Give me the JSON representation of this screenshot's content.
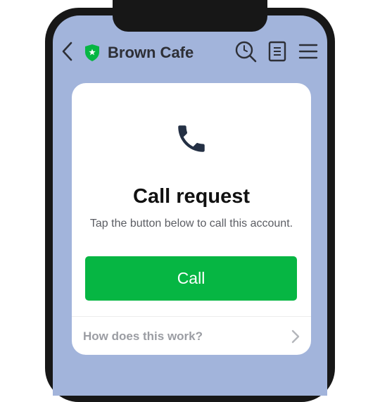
{
  "header": {
    "title": "Brown Cafe",
    "icons": [
      "chevron-left-icon",
      "verified-shield-icon",
      "search-icon",
      "notes-icon",
      "menu-icon"
    ],
    "colors": {
      "background": "#a2b4db",
      "shield": "#06b643",
      "title": "#2d2f36"
    }
  },
  "card": {
    "icon": "phone-icon",
    "title": "Call request",
    "subtitle": "Tap the button below to call this account.",
    "call_button_label": "Call",
    "help_label": "How does this work?",
    "colors": {
      "button": "#06b643",
      "button_text": "#ffffff",
      "help_text": "#9b9da3"
    }
  }
}
